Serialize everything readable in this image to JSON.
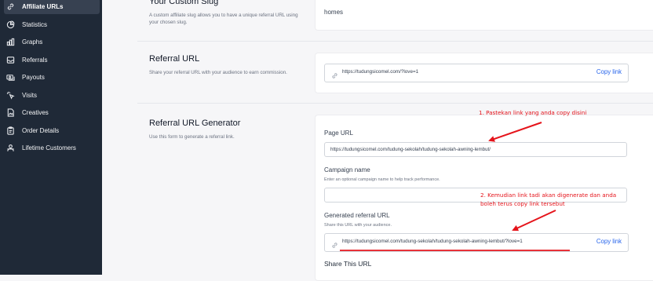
{
  "sidebar": {
    "items": [
      {
        "label": "Affiliate URLs",
        "icon": "link-icon",
        "active": true
      },
      {
        "label": "Statistics",
        "icon": "chart-pie-icon",
        "active": false
      },
      {
        "label": "Graphs",
        "icon": "bar-chart-icon",
        "active": false
      },
      {
        "label": "Referrals",
        "icon": "inbox-icon",
        "active": false
      },
      {
        "label": "Payouts",
        "icon": "cash-icon",
        "active": false
      },
      {
        "label": "Visits",
        "icon": "cursor-click-icon",
        "active": false
      },
      {
        "label": "Creatives",
        "icon": "document-image-icon",
        "active": false
      },
      {
        "label": "Order Details",
        "icon": "clipboard-icon",
        "active": false
      },
      {
        "label": "Lifetime Customers",
        "icon": "users-icon",
        "active": false
      }
    ]
  },
  "custom_slug": {
    "title": "Your Custom Slug",
    "description": "A custom affiliate slug allows you to have a unique referral URL using your chosen slug.",
    "value": "homes"
  },
  "referral_url": {
    "title": "Referral URL",
    "description": "Share your referral URL with your audience to earn commission.",
    "url": "https://tudungsicomel.com/?love=1",
    "copy_label": "Copy link"
  },
  "generator": {
    "title": "Referral URL Generator",
    "description": "Use this form to generate a referral link.",
    "page_url_label": "Page URL",
    "page_url_value": "https://tudungsicomel.com/tudung-sekolah/tudung-sekolah-awning-lembut/",
    "campaign_label": "Campaign name",
    "campaign_help": "Enter an optional campaign name to help track performance.",
    "campaign_value": "",
    "generated_label": "Generated referral URL",
    "generated_help": "Share this URL with your audience.",
    "generated_url": "https://tudungsicomel.com/tudung-sekolah/tudung-sekolah-awning-lembut/?love=1",
    "copy_label": "Copy link",
    "share_label": "Share This URL"
  },
  "annotations": {
    "note1": "1. Pastekan link yang anda copy disini",
    "note2_line1": "2. Kemudian link tadi akan digenerate dan anda",
    "note2_line2": "boleh terus copy link tersebut",
    "color": "#e5141b"
  }
}
